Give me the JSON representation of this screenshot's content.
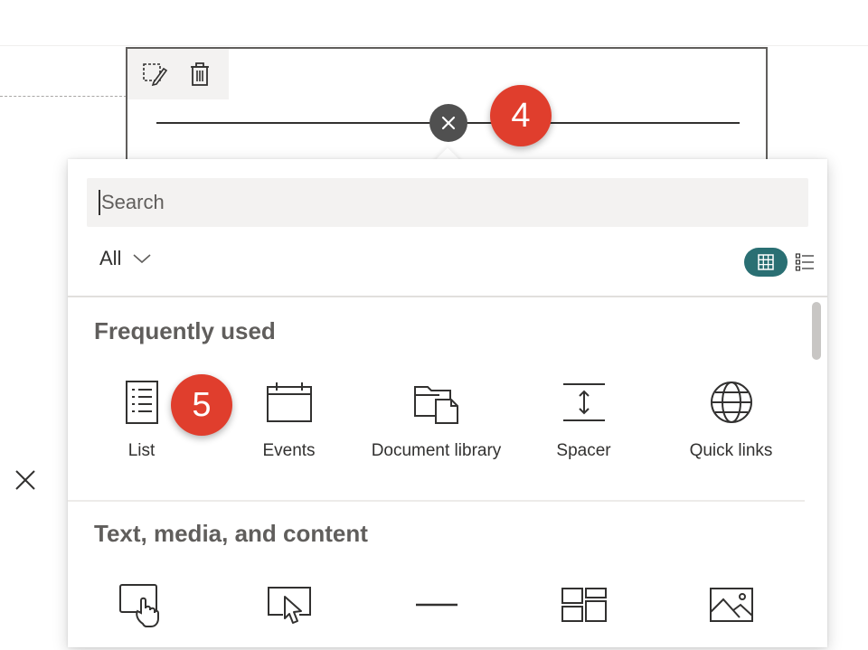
{
  "canvas": {
    "step_badges": [
      "4",
      "5"
    ]
  },
  "picker": {
    "search_placeholder": "Search",
    "filter_label": "All",
    "sections": [
      {
        "title": "Frequently used",
        "items": [
          {
            "label": "List",
            "icon": "list-icon"
          },
          {
            "label": "Events",
            "icon": "calendar-icon"
          },
          {
            "label": "Document library",
            "icon": "document-library-icon"
          },
          {
            "label": "Spacer",
            "icon": "spacer-icon"
          },
          {
            "label": "Quick links",
            "icon": "globe-icon"
          }
        ]
      },
      {
        "title": "Text, media, and content",
        "items": [
          {
            "label": "",
            "icon": "touch-screen-icon"
          },
          {
            "label": "",
            "icon": "presentation-cursor-icon"
          },
          {
            "label": "",
            "icon": "divider-icon"
          },
          {
            "label": "",
            "icon": "layout-icon"
          },
          {
            "label": "",
            "icon": "image-icon"
          }
        ]
      }
    ]
  },
  "colors": {
    "accent": "#2a6f73",
    "badge": "#e03e2d"
  }
}
